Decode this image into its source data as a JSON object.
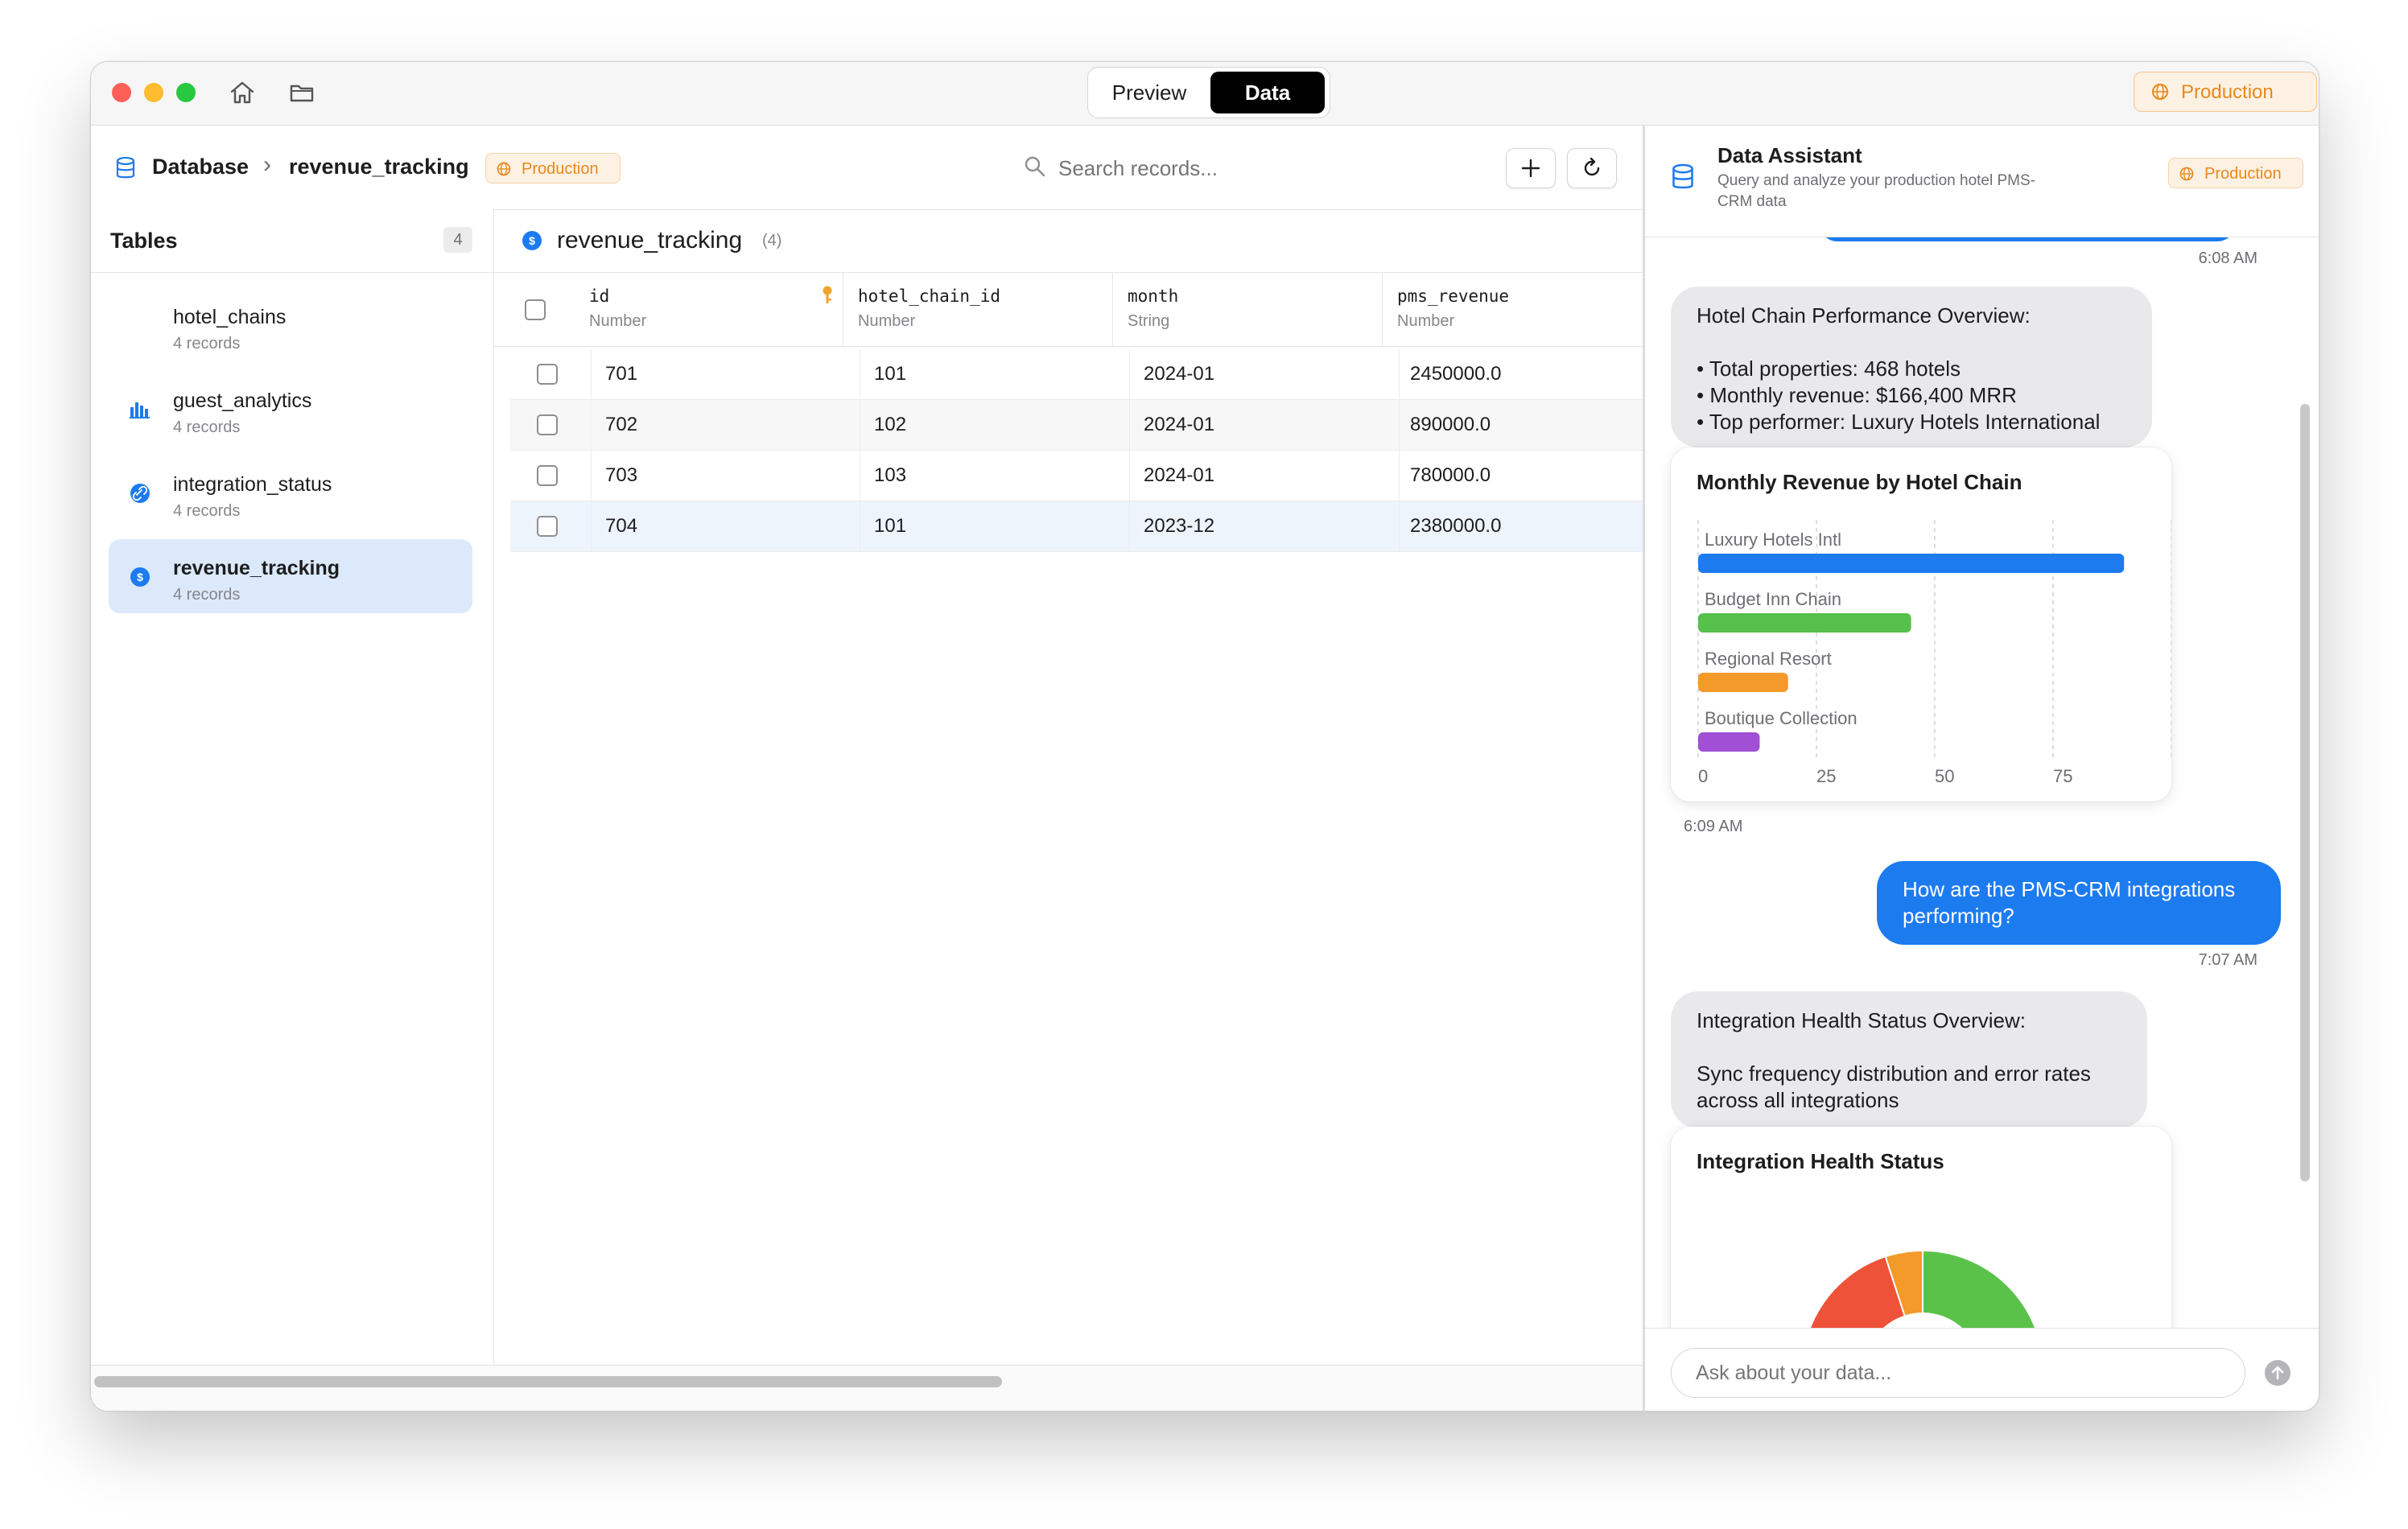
{
  "titlebar": {
    "tabs": [
      "Preview",
      "Data"
    ],
    "active_tab": "Data",
    "environment": "Production"
  },
  "breadcrumb": {
    "root": "Database",
    "current": "revenue_tracking",
    "badge": "Production"
  },
  "search": {
    "placeholder": "Search records..."
  },
  "sidebar": {
    "title": "Tables",
    "count": "4",
    "items": [
      {
        "name": "hotel_chains",
        "sub": "4 records",
        "icon": "none"
      },
      {
        "name": "guest_analytics",
        "sub": "4 records",
        "icon": "bar-chart-icon"
      },
      {
        "name": "integration_status",
        "sub": "4 records",
        "icon": "link-icon"
      },
      {
        "name": "revenue_tracking",
        "sub": "4 records",
        "icon": "dollar-icon",
        "selected": true
      }
    ]
  },
  "table": {
    "name": "revenue_tracking",
    "count": "(4)",
    "columns": [
      {
        "name": "id",
        "type": "Number",
        "primary_key": true
      },
      {
        "name": "hotel_chain_id",
        "type": "Number"
      },
      {
        "name": "month",
        "type": "String"
      },
      {
        "name": "pms_revenue",
        "type": "Number"
      }
    ],
    "rows": [
      [
        "701",
        "101",
        "2024-01",
        "2450000.0"
      ],
      [
        "702",
        "102",
        "2024-01",
        "890000.0"
      ],
      [
        "703",
        "103",
        "2024-01",
        "780000.0"
      ],
      [
        "704",
        "101",
        "2023-12",
        "2380000.0"
      ]
    ]
  },
  "assistant": {
    "title": "Data Assistant",
    "subtitle_line1": "Query and analyze your production hotel PMS-",
    "subtitle_line2": "CRM data",
    "badge": "Production",
    "input_placeholder": "Ask about your data...",
    "messages": {
      "ts0": "6:08 AM",
      "overview_title": "Hotel Chain Performance Overview:",
      "overview_lines": [
        "• Total properties: 468 hotels",
        "• Monthly revenue: $166,400 MRR",
        "• Top performer: Luxury Hotels International"
      ],
      "ts1": "6:09 AM",
      "user_question_line1": "How are the PMS-CRM integrations",
      "user_question_line2": "performing?",
      "ts2": "7:07 AM",
      "health_title": "Integration Health Status Overview:",
      "health_line1": "Sync frequency distribution and error rates",
      "health_line2": "across all integrations"
    }
  },
  "chart_data": [
    {
      "type": "bar",
      "orientation": "horizontal",
      "title": "Monthly Revenue by Hotel Chain",
      "categories": [
        "Luxury Hotels Intl",
        "Budget Inn Chain",
        "Regional Resort",
        "Boutique Collection"
      ],
      "values": [
        90,
        45,
        19,
        13
      ],
      "colors": [
        "#1d7bf0",
        "#55c04a",
        "#f39a2b",
        "#a14fd4"
      ],
      "xticks": [
        "0",
        "25",
        "50",
        "75"
      ],
      "xlim": [
        0,
        100
      ],
      "grid": true
    },
    {
      "type": "pie",
      "style": "donut",
      "title": "Integration Health Status",
      "slices": [
        {
          "value": 50,
          "color": "#5ac248"
        },
        {
          "value": 45,
          "color": "#ee5238"
        },
        {
          "value": 5,
          "color": "#f39a2b"
        }
      ]
    }
  ]
}
